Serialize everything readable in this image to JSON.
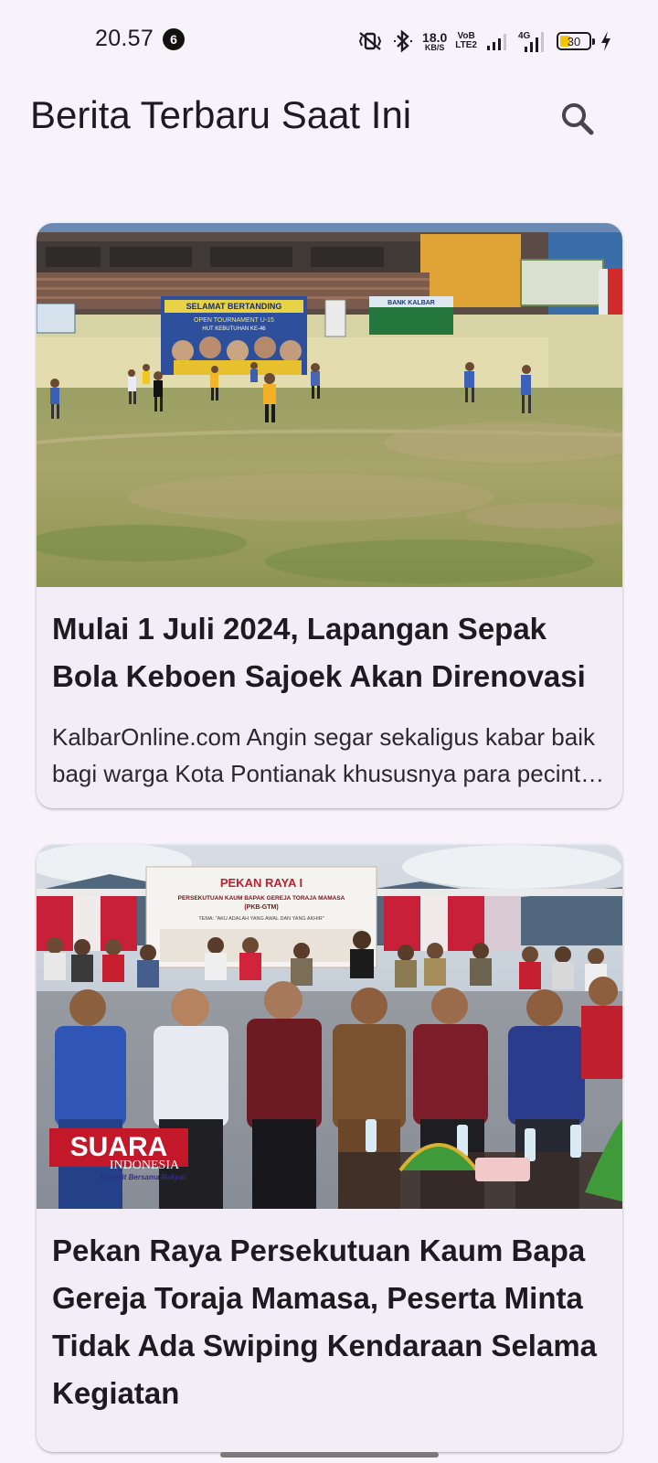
{
  "status_bar": {
    "time": "20.57",
    "notification_count": "6",
    "net_speed_value": "18.0",
    "net_speed_unit": "KB/S",
    "volte_top": "VoB",
    "volte_bottom": "LTE2",
    "network_type": "4G",
    "battery_level": "30"
  },
  "app_bar": {
    "title": "Berita Terbaru Saat Ini",
    "search_icon": "search-icon"
  },
  "articles": [
    {
      "title": "Mulai 1 Juli 2024, Lapangan Sepak Bola Keboen Sajoek Akan Direnovasi",
      "description": "KalbarOnline.com Angin segar sekaligus kabar baik bagi warga Kota Pontianak khususnya para pecinta sepak bola",
      "image": {
        "banner_text": "SELAMAT BERTANDING",
        "banner_subtext": "OPEN TOURNAMENT U-15",
        "banner_subtext2": "HUT KEBUTUHAN KE-46",
        "sign_text": "BANK KALBAR"
      }
    },
    {
      "title": "Pekan Raya Persekutuan Kaum Bapa Gereja Toraja Mamasa, Peserta Minta Tidak Ada Swiping Kendaraan Selama Kegiatan",
      "description": "",
      "image": {
        "banner_text": "PEKAN RAYA I",
        "banner_subtext": "PERSEKUTUAN KAUM BAPAK GEREJA TORAJA MAMASA",
        "banner_subtext2": "(PKB-GTM)",
        "banner_subtext3": "TEMA: \"AKU ADALAH YANG AWAL DAN YANG AKHIR\"",
        "logo_text": "SUARA",
        "logo_sub": "INDONESIA",
        "logo_tagline": "Bangkit Bersama Rakyat"
      }
    }
  ]
}
